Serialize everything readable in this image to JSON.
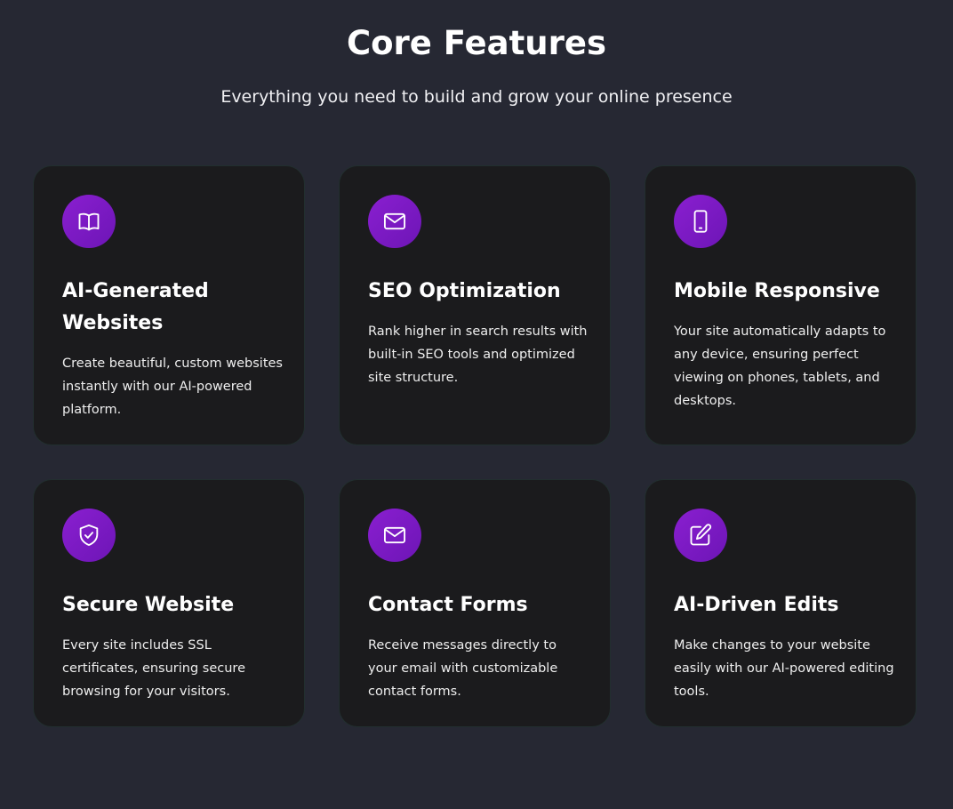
{
  "section": {
    "title": "Core Features",
    "subtitle": "Everything you need to build and grow your online presence"
  },
  "colors": {
    "background": "#262833",
    "card": "#1b1b1d",
    "accent": "#8a1fd0"
  },
  "features": [
    {
      "icon": "book-icon",
      "title": "AI-Generated Websites",
      "description": "Create beautiful, custom websites instantly with our AI-powered platform."
    },
    {
      "icon": "mail-icon",
      "title": "SEO Optimization",
      "description": "Rank higher in search results with built-in SEO tools and optimized site structure."
    },
    {
      "icon": "smartphone-icon",
      "title": "Mobile Responsive",
      "description": "Your site automatically adapts to any device, ensuring perfect viewing on phones, tablets, and desktops."
    },
    {
      "icon": "shield-check-icon",
      "title": "Secure Website",
      "description": "Every site includes SSL certificates, ensuring secure browsing for your visitors."
    },
    {
      "icon": "mail-icon",
      "title": "Contact Forms",
      "description": "Receive messages directly to your email with customizable contact forms."
    },
    {
      "icon": "edit-icon",
      "title": "AI-Driven Edits",
      "description": "Make changes to your website easily with our AI-powered editing tools."
    }
  ]
}
